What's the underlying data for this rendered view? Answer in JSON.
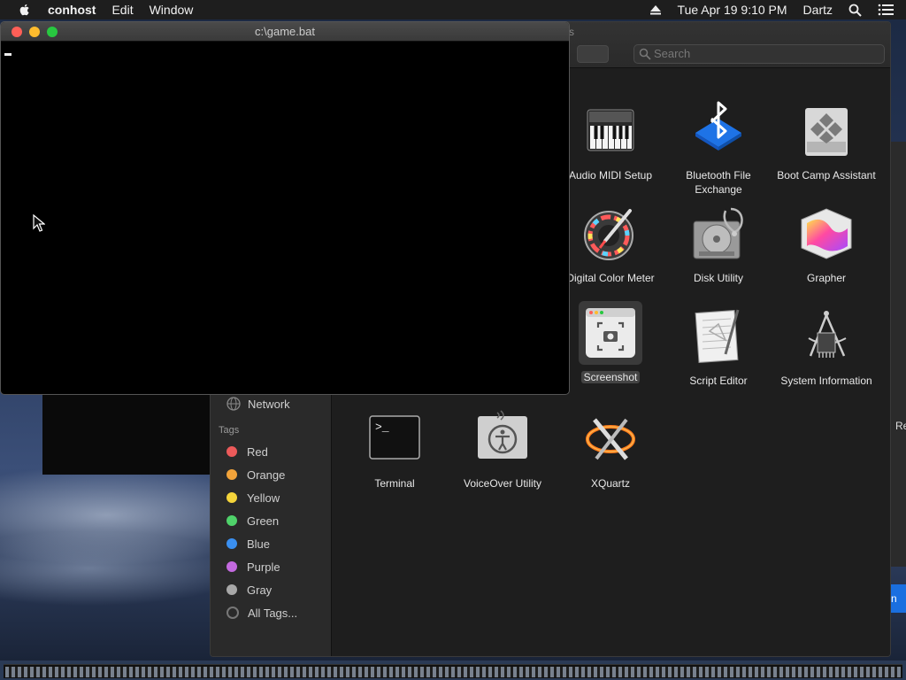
{
  "menubar": {
    "app_name": "conhost",
    "menus": [
      "Edit",
      "Window"
    ],
    "datetime": "Tue Apr 19  9:10 PM",
    "user": "Dartz"
  },
  "console": {
    "title": "c:\\game.bat"
  },
  "finder": {
    "window_title_fragment": "s",
    "search_placeholder": "Search",
    "sidebar": {
      "network_label": "Network",
      "tags_heading": "Tags",
      "tags": [
        {
          "label": "Red",
          "color": "#ec5a5a"
        },
        {
          "label": "Orange",
          "color": "#f2a33a"
        },
        {
          "label": "Yellow",
          "color": "#f4d43a"
        },
        {
          "label": "Green",
          "color": "#4fd26a"
        },
        {
          "label": "Blue",
          "color": "#3a8ff0"
        },
        {
          "label": "Purple",
          "color": "#c46ae0"
        },
        {
          "label": "Gray",
          "color": "#a8a8a8"
        }
      ],
      "all_tags_label": "All Tags..."
    },
    "apps": [
      {
        "label": "Audio MIDI Setup",
        "icon": "audio-midi-setup-icon"
      },
      {
        "label": "Bluetooth File Exchange",
        "icon": "bluetooth-file-exchange-icon"
      },
      {
        "label": "Boot Camp Assistant",
        "icon": "boot-camp-assistant-icon"
      },
      {
        "label": "Digital Color Meter",
        "icon": "digital-color-meter-icon"
      },
      {
        "label": "Disk Utility",
        "icon": "disk-utility-icon"
      },
      {
        "label": "Grapher",
        "icon": "grapher-icon"
      },
      {
        "label": "Screenshot",
        "icon": "screenshot-icon",
        "selected": true
      },
      {
        "label": "Script Editor",
        "icon": "script-editor-icon"
      },
      {
        "label": "System Information",
        "icon": "system-information-icon"
      },
      {
        "label": "Terminal",
        "icon": "terminal-icon"
      },
      {
        "label": "VoiceOver Utility",
        "icon": "voiceover-utility-icon"
      },
      {
        "label": "XQuartz",
        "icon": "xquartz-icon"
      }
    ]
  },
  "background_window": {
    "fragment_text": "Re",
    "button_fragment": "n"
  },
  "colors": {
    "close": "#ff5f57",
    "minimize": "#febc2e",
    "zoom": "#28c840"
  }
}
